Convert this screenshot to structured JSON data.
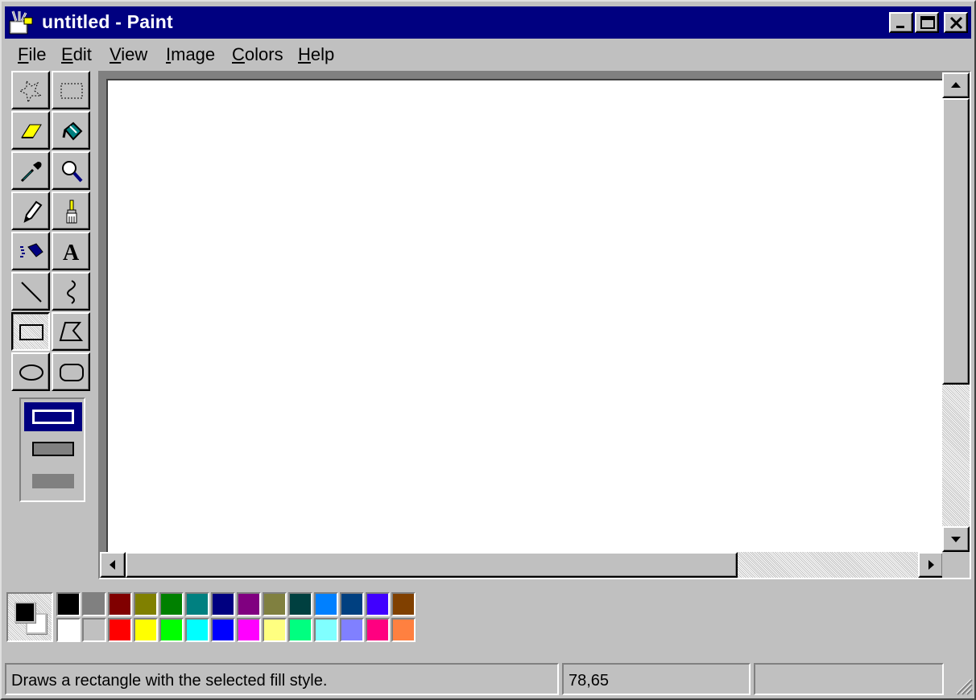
{
  "window": {
    "title": "untitled - Paint",
    "app_icon": "paint-app-icon",
    "controls": {
      "minimize_icon": "minimize-icon",
      "maximize_icon": "maximize-icon",
      "close_icon": "close-icon"
    }
  },
  "menu": {
    "items": [
      {
        "label": "File"
      },
      {
        "label": "Edit"
      },
      {
        "label": "View"
      },
      {
        "label": "Image"
      },
      {
        "label": "Colors"
      },
      {
        "label": "Help"
      }
    ]
  },
  "toolbox": {
    "tools": [
      {
        "name": "free-form-select",
        "icon": "free-form-select-icon",
        "selected": false
      },
      {
        "name": "select",
        "icon": "rectangle-select-icon",
        "selected": false
      },
      {
        "name": "eraser",
        "icon": "eraser-icon",
        "selected": false
      },
      {
        "name": "fill-with-color",
        "icon": "paint-bucket-icon",
        "selected": false
      },
      {
        "name": "pick-color",
        "icon": "eyedropper-icon",
        "selected": false
      },
      {
        "name": "magnifier",
        "icon": "magnifier-icon",
        "selected": false
      },
      {
        "name": "pencil",
        "icon": "pencil-icon",
        "selected": false
      },
      {
        "name": "brush",
        "icon": "brush-icon",
        "selected": false
      },
      {
        "name": "airbrush",
        "icon": "airbrush-icon",
        "selected": false
      },
      {
        "name": "text",
        "icon": "text-icon",
        "selected": false
      },
      {
        "name": "line",
        "icon": "line-icon",
        "selected": false
      },
      {
        "name": "curve",
        "icon": "curve-icon",
        "selected": false
      },
      {
        "name": "rectangle",
        "icon": "rectangle-icon",
        "selected": true
      },
      {
        "name": "polygon",
        "icon": "polygon-icon",
        "selected": false
      },
      {
        "name": "ellipse",
        "icon": "ellipse-icon",
        "selected": false
      },
      {
        "name": "rounded-rectangle",
        "icon": "rounded-rectangle-icon",
        "selected": false
      }
    ],
    "fill_styles": [
      {
        "name": "outline-only",
        "selected": true
      },
      {
        "name": "outline-and-fill",
        "selected": false
      },
      {
        "name": "fill-only",
        "selected": false
      }
    ]
  },
  "colors": {
    "foreground": "#000000",
    "background": "#ffffff",
    "palette_top": [
      "#000000",
      "#808080",
      "#800000",
      "#808000",
      "#008000",
      "#008080",
      "#000080",
      "#800080",
      "#808040",
      "#004040",
      "#0080ff",
      "#004080",
      "#4000ff",
      "#804000"
    ],
    "palette_bottom": [
      "#ffffff",
      "#c0c0c0",
      "#ff0000",
      "#ffff00",
      "#00ff00",
      "#00ffff",
      "#0000ff",
      "#ff00ff",
      "#ffff80",
      "#00ff80",
      "#80ffff",
      "#8080ff",
      "#ff0080",
      "#ff8040"
    ],
    "title_bar": "#000080",
    "face": "#c0c0c0"
  },
  "status": {
    "message": "Draws a rectangle with the selected fill style.",
    "coordinates": "78,65",
    "size": ""
  }
}
